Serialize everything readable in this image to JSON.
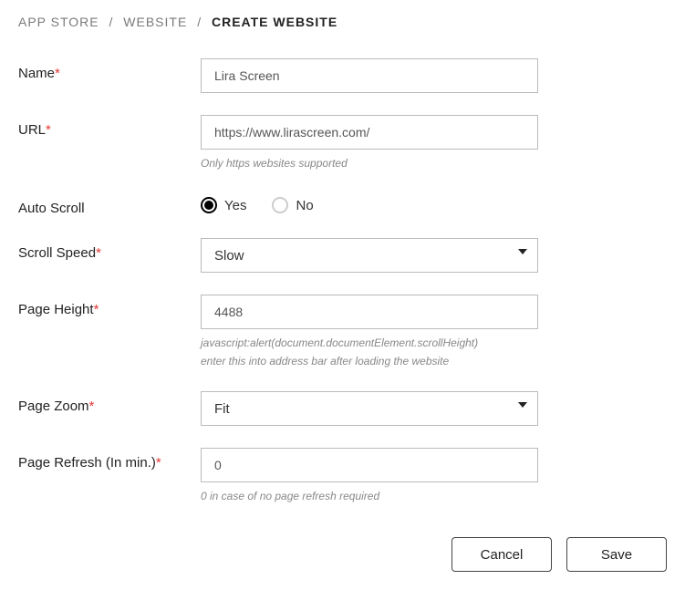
{
  "breadcrumb": {
    "item0": "APP STORE",
    "item1": "WEBSITE",
    "current": "CREATE WEBSITE",
    "sep": "/"
  },
  "fields": {
    "name": {
      "label": "Name",
      "value": "Lira Screen"
    },
    "url": {
      "label": "URL",
      "value": "https://www.lirascreen.com/",
      "help": "Only https websites supported"
    },
    "autoScroll": {
      "label": "Auto Scroll",
      "yes": "Yes",
      "no": "No"
    },
    "scrollSpeed": {
      "label": "Scroll Speed",
      "value": "Slow"
    },
    "pageHeight": {
      "label": "Page Height",
      "value": "4488",
      "help1": "javascript:alert(document.documentElement.scrollHeight)",
      "help2": "enter this into address bar after loading the website"
    },
    "pageZoom": {
      "label": "Page Zoom",
      "value": "Fit"
    },
    "pageRefresh": {
      "label": "Page Refresh (In min.)",
      "value": "0",
      "help": "0 in case of no page refresh required"
    }
  },
  "actions": {
    "cancel": "Cancel",
    "save": "Save"
  },
  "required": "*"
}
